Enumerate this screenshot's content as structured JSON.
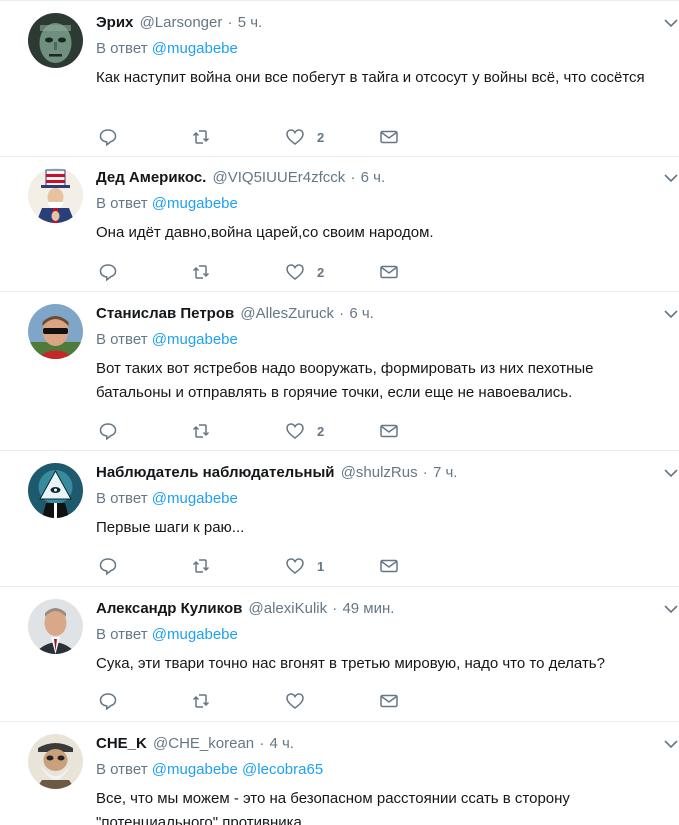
{
  "reply_prefix": "В ответ",
  "tweets": [
    {
      "name": "Эрих",
      "handle": "@Larsonger",
      "time": "5 ч.",
      "mentions": [
        "@mugabebe"
      ],
      "text": "Как наступит война они все побегут в тайга и отсосут у войны всё, что сосётся",
      "likes": "2",
      "avatar": "mask-avatar"
    },
    {
      "name": "Дед Америкос.",
      "handle": "@VIQ5IUUEr4zfcck",
      "time": "6 ч.",
      "mentions": [
        "@mugabebe"
      ],
      "text": "Она идёт давно,война  царей,со своим народом.",
      "likes": "2",
      "avatar": "uncle-sam-avatar"
    },
    {
      "name": "Станислав Петров",
      "handle": "@AllesZuruck",
      "time": "6 ч.",
      "mentions": [
        "@mugabebe"
      ],
      "text": "Вот таких вот ястребов надо вооружать, формировать из них пехотные батальоны и отправлять в горячие точки, если еще не навоевались.",
      "likes": "2",
      "avatar": "man-sunglasses-avatar"
    },
    {
      "name": "Наблюдатель наблюдательный",
      "handle": "@shulzRus",
      "time": "7 ч.",
      "mentions": [
        "@mugabebe"
      ],
      "text": "Первые шаги к раю...",
      "likes": "1",
      "avatar": "eye-pyramid-avatar"
    },
    {
      "name": "Александр Куликов",
      "handle": "@alexiKulik",
      "time": "49 мин.",
      "mentions": [
        "@mugabebe"
      ],
      "text": "Сука, эти твари точно нас вгонят в третью мировую, надо что то делать?",
      "likes": "",
      "avatar": "man-suit-avatar"
    },
    {
      "name": "CHE_K",
      "handle": "@CHE_korean",
      "time": "4 ч.",
      "mentions": [
        "@mugabebe",
        "@lecobra65"
      ],
      "text": "Все, что мы можем - это на безопасном расстоянии ссать в сторону \"потенциального\" противника",
      "likes": "",
      "avatar": "old-man-avatar"
    }
  ]
}
